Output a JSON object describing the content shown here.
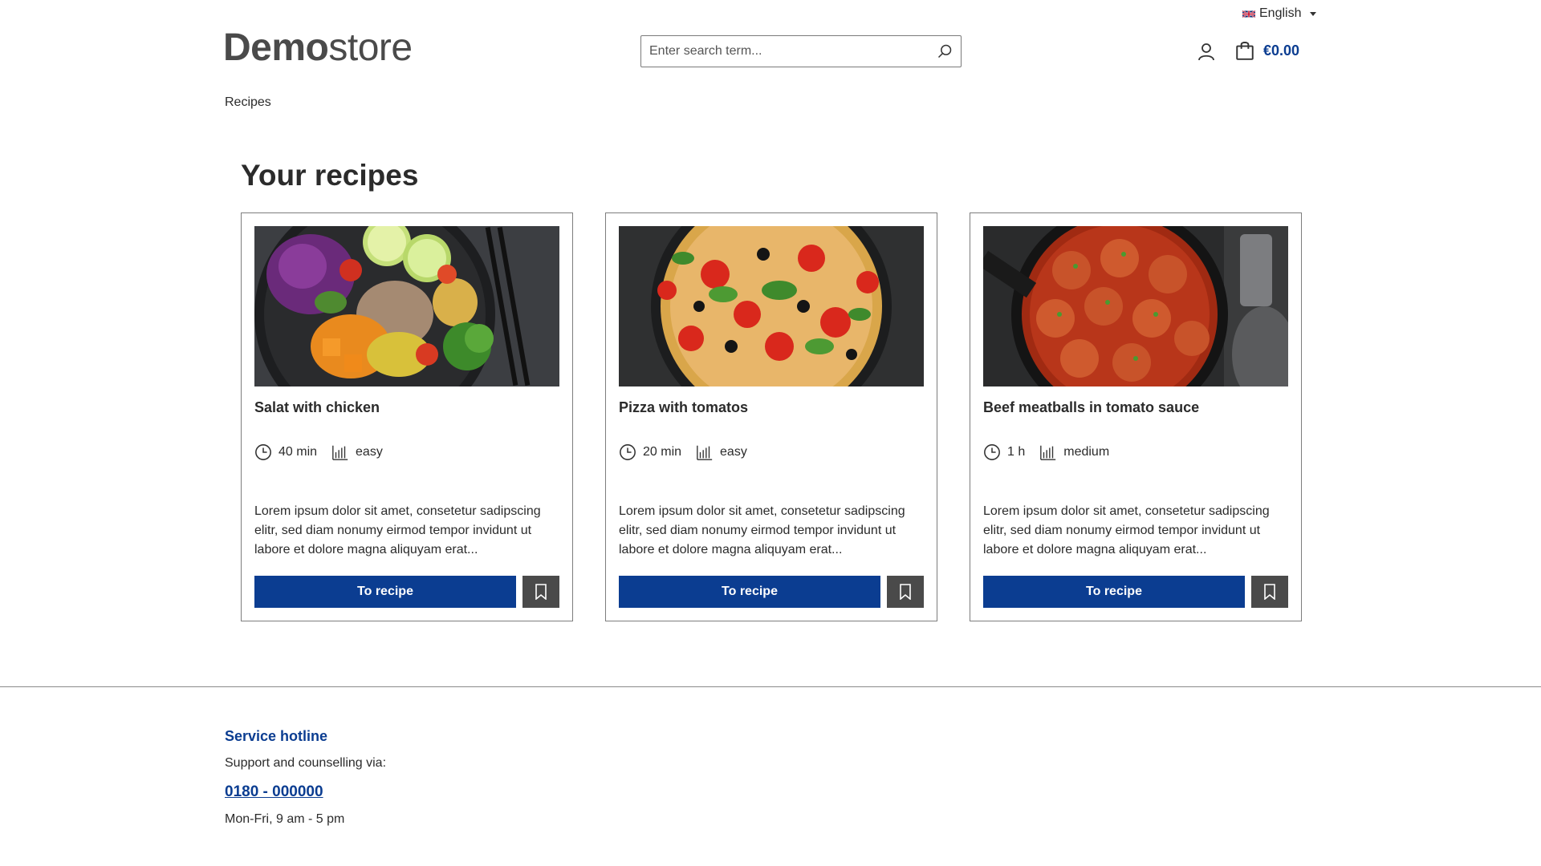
{
  "header": {
    "language": "English",
    "logo_bold": "Demo",
    "logo_light": "store",
    "search_placeholder": "Enter search term...",
    "cart_total": "€0.00"
  },
  "breadcrumb": "Recipes",
  "page_title": "Your recipes",
  "recipes": [
    {
      "name": "Salat with chicken",
      "time": "40 min",
      "difficulty": "easy",
      "description": "Lorem ipsum dolor sit amet, consetetur sadipscing elitr, sed diam nonumy eirmod tempor invidunt ut labore et dolore magna aliquyam erat...",
      "button": "To recipe"
    },
    {
      "name": "Pizza with tomatos",
      "time": "20 min",
      "difficulty": "easy",
      "description": "Lorem ipsum dolor sit amet, consetetur sadipscing elitr, sed diam nonumy eirmod tempor invidunt ut labore et dolore magna aliquyam erat...",
      "button": "To recipe"
    },
    {
      "name": "Beef meatballs in tomato sauce",
      "time": "1 h",
      "difficulty": "medium",
      "description": "Lorem ipsum dolor sit amet, consetetur sadipscing elitr, sed diam nonumy eirmod tempor invidunt ut labore et dolore magna aliquyam erat...",
      "button": "To recipe"
    }
  ],
  "footer": {
    "hotline_title": "Service hotline",
    "support_text": "Support and counselling via:",
    "phone": "0180 - 000000",
    "hours": "Mon-Fri, 9 am - 5 pm"
  },
  "colors": {
    "primary": "#0b3d91",
    "bookmark_bg": "#4a4a4a",
    "text": "#2b2b2b"
  }
}
